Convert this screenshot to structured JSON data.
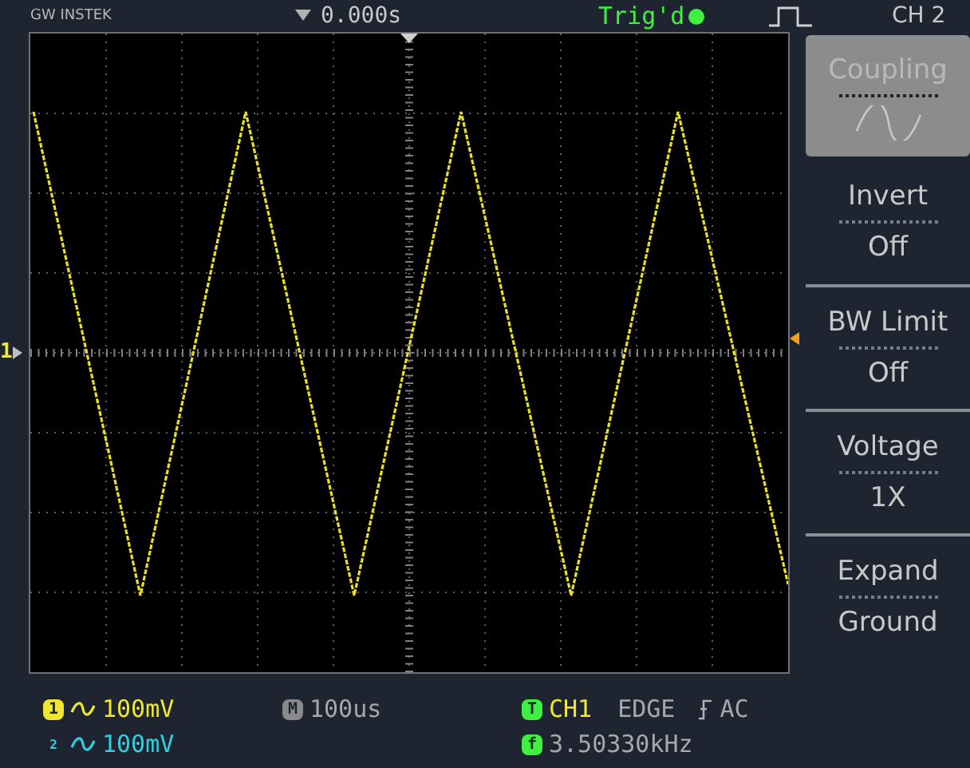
{
  "top_bar": {
    "brand": "GW INSTEK",
    "time_offset": "0.000s",
    "trigger_status": "Trig'd",
    "menu_title": "CH 2"
  },
  "display": {
    "channel_marker": "1"
  },
  "menu": [
    {
      "kind": "icon",
      "label": "Coupling",
      "selected": true
    },
    {
      "kind": "text",
      "label": "Invert",
      "value": "Off",
      "selected": false
    },
    {
      "kind": "text",
      "label": "BW Limit",
      "value": "Off",
      "selected": false
    },
    {
      "kind": "text",
      "label": "Voltage",
      "value": "1X",
      "selected": false
    },
    {
      "kind": "text",
      "label": "Expand",
      "value": "Ground",
      "selected": false
    }
  ],
  "status": {
    "channels": [
      {
        "badge": "1",
        "scale": "100mV",
        "color": "#f0e830"
      },
      {
        "badge": "2",
        "scale": "100mV",
        "color": "#30d0e0"
      }
    ],
    "timebase": {
      "badge": "M",
      "value": "100us"
    },
    "trigger": {
      "badge": "T",
      "source": "CH1",
      "type": "EDGE",
      "coupling": "AC"
    },
    "frequency": {
      "badge": "f",
      "value": "3.50330kHz"
    }
  }
}
